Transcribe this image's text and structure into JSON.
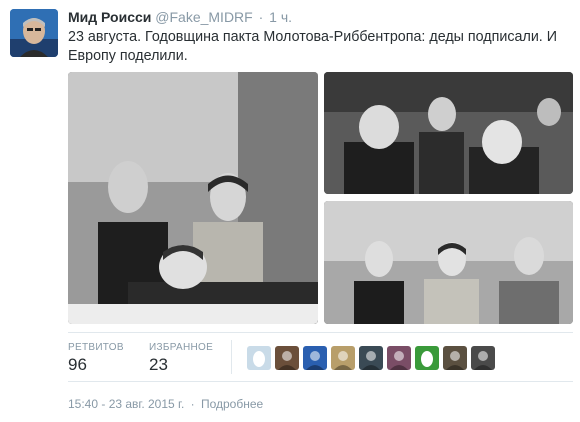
{
  "tweet": {
    "fullname": "Мид Роисси",
    "username": "@Fake_MIDRF",
    "separator": "·",
    "time": "1 ч.",
    "text": "23 августа. Годовщина пакта Молотова-Риббентропа: деды подписали. И Европу поделили.",
    "avatar_icon": "avatar-photo",
    "photos": [
      {
        "icon": "historical-photo-signing"
      },
      {
        "icon": "historical-photo-group"
      },
      {
        "icon": "historical-photo-portrait"
      }
    ]
  },
  "stats": {
    "retweets_label": "РЕТВИТОВ",
    "retweets_value": "96",
    "favorites_label": "ИЗБРАННОЕ",
    "favorites_value": "23"
  },
  "favoriters": [
    {
      "icon": "egg-icon",
      "color": "#c9dbe8"
    },
    {
      "icon": "user-avatar",
      "color": "#6b4f3a"
    },
    {
      "icon": "user-avatar",
      "color": "#2a5fb0"
    },
    {
      "icon": "user-avatar",
      "color": "#b89e6a"
    },
    {
      "icon": "user-avatar",
      "color": "#3a4a55"
    },
    {
      "icon": "user-avatar",
      "color": "#7a4d66"
    },
    {
      "icon": "egg-icon",
      "color": "#3a9a3a"
    },
    {
      "icon": "user-avatar",
      "color": "#5b5040"
    },
    {
      "icon": "user-avatar",
      "color": "#4a4a4a"
    }
  ],
  "footer": {
    "timestamp": "15:40 - 23 авг. 2015 г.",
    "separator": "·",
    "details_link": "Подробнее"
  },
  "colors": {
    "text": "#292f33",
    "muted": "#8899a6",
    "divider": "#e1e8ed"
  }
}
